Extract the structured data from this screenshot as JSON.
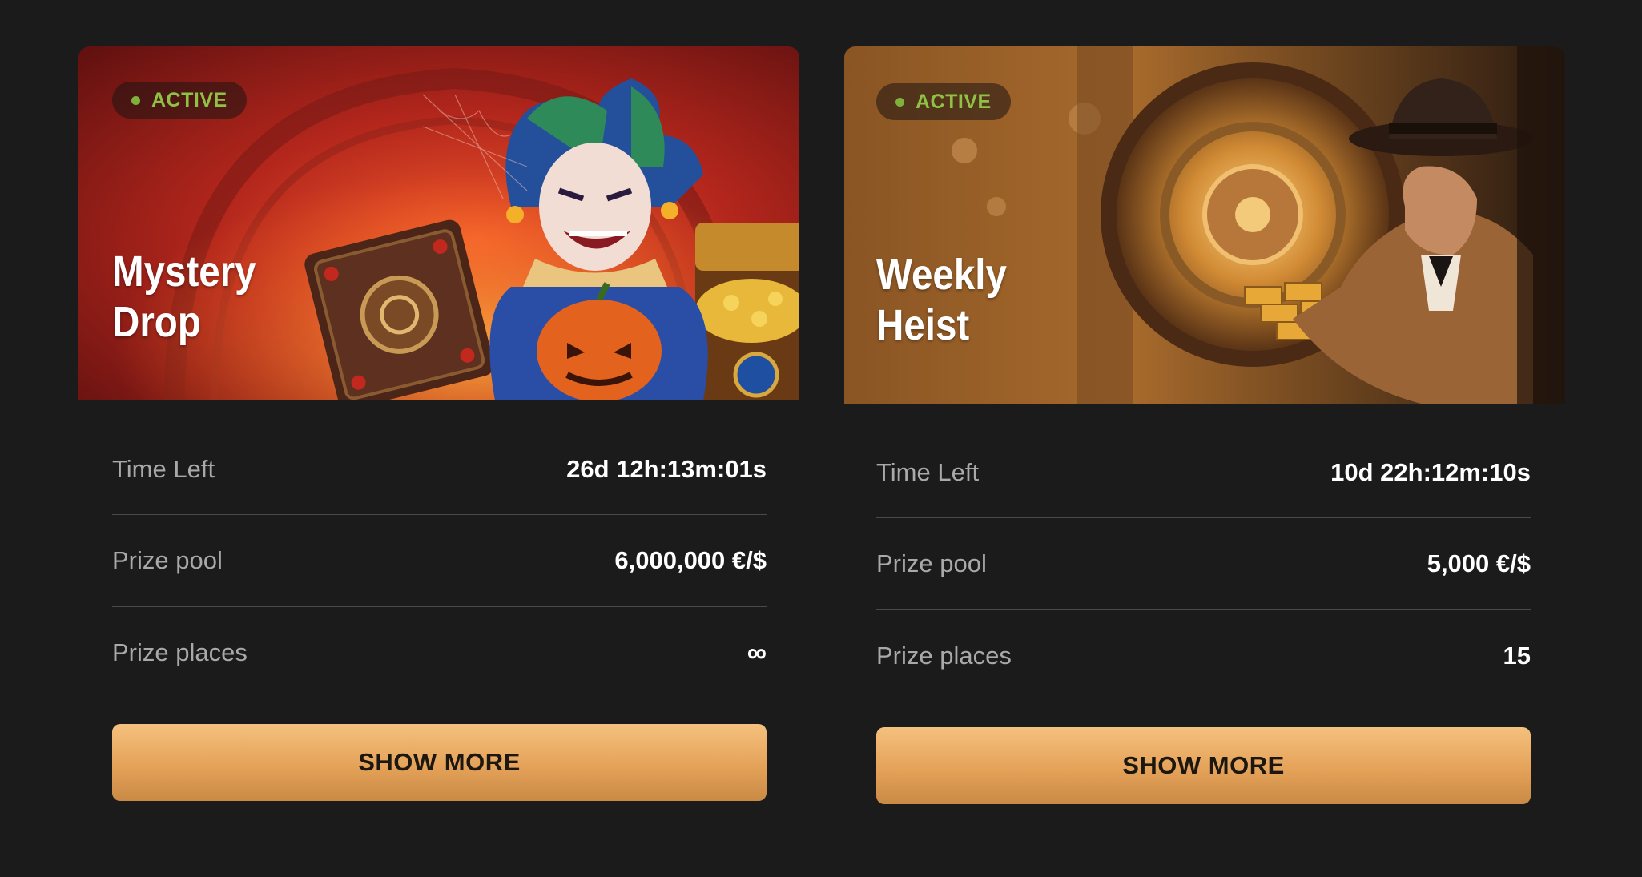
{
  "tournaments": [
    {
      "status": "ACTIVE",
      "title_line1": "Mystery",
      "title_line2": "Drop",
      "rows": [
        {
          "label": "Time Left",
          "value": "26d 12h:13m:01s"
        },
        {
          "label": "Prize pool",
          "value": "6,000,000 €/$"
        },
        {
          "label": "Prize places",
          "value": "∞"
        }
      ],
      "button_label": "SHOW MORE"
    },
    {
      "status": "ACTIVE",
      "title_line1": "Weekly",
      "title_line2": "Heist",
      "rows": [
        {
          "label": "Time Left",
          "value": "10d 22h:12m:10s"
        },
        {
          "label": "Prize pool",
          "value": "5,000 €/$"
        },
        {
          "label": "Prize places",
          "value": "15"
        }
      ],
      "button_label": "SHOW MORE"
    }
  ],
  "colors": {
    "background": "#1b1b1c",
    "status_green": "#8fc144",
    "button_gold": "#e5a259",
    "label_gray": "#a9a9aa"
  }
}
